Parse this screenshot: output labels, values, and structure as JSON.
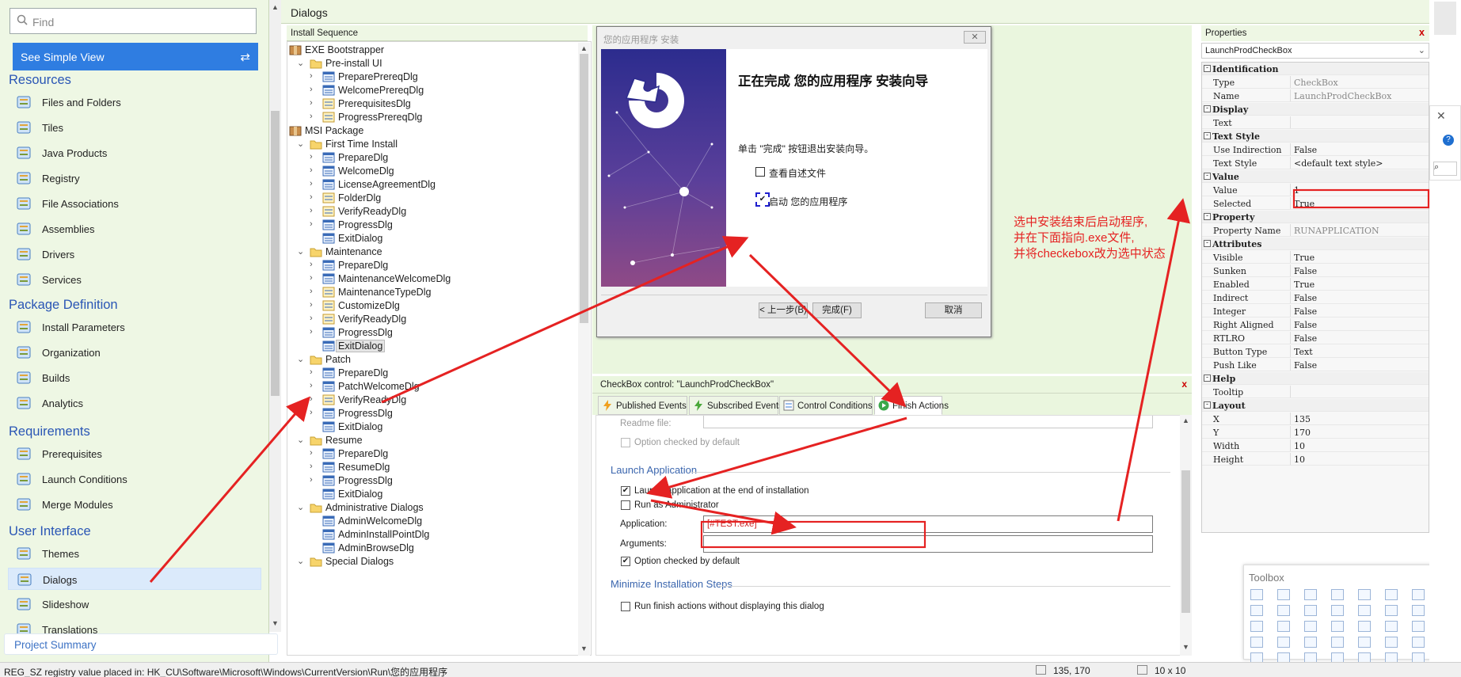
{
  "left_nav": {
    "find_placeholder": "Find",
    "simple_view_label": "See Simple View",
    "sections": [
      {
        "title": "Resources",
        "items": [
          "Files and Folders",
          "Tiles",
          "Java Products",
          "Registry",
          "File Associations",
          "Assemblies",
          "Drivers",
          "Services"
        ]
      },
      {
        "title": "Package Definition",
        "items": [
          "Install Parameters",
          "Organization",
          "Builds",
          "Analytics"
        ]
      },
      {
        "title": "Requirements",
        "items": [
          "Prerequisites",
          "Launch Conditions",
          "Merge Modules"
        ]
      },
      {
        "title": "User Interface",
        "items": [
          "Themes",
          "Dialogs",
          "Slideshow",
          "Translations"
        ]
      }
    ],
    "selected_item": "Dialogs",
    "project_summary": "Project Summary"
  },
  "main_title": "Dialogs",
  "install_sequence": {
    "header": "Install Sequence",
    "nodes": [
      {
        "level": 0,
        "label": "EXE Bootstrapper",
        "type": "package"
      },
      {
        "level": 1,
        "label": "Pre-install UI",
        "type": "folder",
        "expanded": true
      },
      {
        "level": 2,
        "label": "PreparePrereqDlg",
        "type": "dialog"
      },
      {
        "level": 2,
        "label": "WelcomePrereqDlg",
        "type": "dialog"
      },
      {
        "level": 2,
        "label": "PrerequisitesDlg",
        "type": "dialog-alt"
      },
      {
        "level": 2,
        "label": "ProgressPrereqDlg",
        "type": "dialog-alt"
      },
      {
        "level": 0,
        "label": "MSI Package",
        "type": "package"
      },
      {
        "level": 1,
        "label": "First Time Install",
        "type": "folder",
        "expanded": true
      },
      {
        "level": 2,
        "label": "PrepareDlg",
        "type": "dialog"
      },
      {
        "level": 2,
        "label": "WelcomeDlg",
        "type": "dialog"
      },
      {
        "level": 2,
        "label": "LicenseAgreementDlg",
        "type": "dialog"
      },
      {
        "level": 2,
        "label": "FolderDlg",
        "type": "dialog-alt"
      },
      {
        "level": 2,
        "label": "VerifyReadyDlg",
        "type": "dialog-alt"
      },
      {
        "level": 2,
        "label": "ProgressDlg",
        "type": "dialog"
      },
      {
        "level": 2,
        "label": "ExitDialog",
        "type": "dialog",
        "leaf": true
      },
      {
        "level": 1,
        "label": "Maintenance",
        "type": "folder",
        "expanded": true
      },
      {
        "level": 2,
        "label": "PrepareDlg",
        "type": "dialog"
      },
      {
        "level": 2,
        "label": "MaintenanceWelcomeDlg",
        "type": "dialog"
      },
      {
        "level": 2,
        "label": "MaintenanceTypeDlg",
        "type": "dialog-alt"
      },
      {
        "level": 2,
        "label": "CustomizeDlg",
        "type": "dialog-alt"
      },
      {
        "level": 2,
        "label": "VerifyReadyDlg",
        "type": "dialog-alt"
      },
      {
        "level": 2,
        "label": "ProgressDlg",
        "type": "dialog"
      },
      {
        "level": 2,
        "label": "ExitDialog",
        "type": "dialog",
        "leaf": true,
        "selected": true
      },
      {
        "level": 1,
        "label": "Patch",
        "type": "folder",
        "expanded": true
      },
      {
        "level": 2,
        "label": "PrepareDlg",
        "type": "dialog"
      },
      {
        "level": 2,
        "label": "PatchWelcomeDlg",
        "type": "dialog"
      },
      {
        "level": 2,
        "label": "VerifyReadyDlg",
        "type": "dialog-alt"
      },
      {
        "level": 2,
        "label": "ProgressDlg",
        "type": "dialog"
      },
      {
        "level": 2,
        "label": "ExitDialog",
        "type": "dialog",
        "leaf": true
      },
      {
        "level": 1,
        "label": "Resume",
        "type": "folder",
        "expanded": true
      },
      {
        "level": 2,
        "label": "PrepareDlg",
        "type": "dialog"
      },
      {
        "level": 2,
        "label": "ResumeDlg",
        "type": "dialog"
      },
      {
        "level": 2,
        "label": "ProgressDlg",
        "type": "dialog"
      },
      {
        "level": 2,
        "label": "ExitDialog",
        "type": "dialog",
        "leaf": true
      },
      {
        "level": 1,
        "label": "Administrative Dialogs",
        "type": "folder",
        "expanded": true
      },
      {
        "level": 2,
        "label": "AdminWelcomeDlg",
        "type": "dialog",
        "leaf": true
      },
      {
        "level": 2,
        "label": "AdminInstallPointDlg",
        "type": "dialog",
        "leaf": true
      },
      {
        "level": 2,
        "label": "AdminBrowseDlg",
        "type": "dialog",
        "leaf": true
      },
      {
        "level": 1,
        "label": "Special Dialogs",
        "type": "folder",
        "expanded": true
      }
    ]
  },
  "preview_dialog": {
    "title": "您的应用程序 安装",
    "close_glyph": "✕",
    "heading": "正在完成 您的应用程序 安装向导",
    "body": "单击 \"完成\" 按钮退出安装向导。",
    "readme_checkbox": "查看自述文件",
    "launch_checkbox": "启动 您的应用程序",
    "buttons": {
      "back": "< 上一步(B)",
      "finish": "完成(F)",
      "cancel": "取消"
    }
  },
  "checkbox_control": {
    "header": "CheckBox control: \"LaunchProdCheckBox\"",
    "close_glyph": "x",
    "tabs": [
      "Published Events",
      "Subscribed Events",
      "Control Conditions",
      "Finish Actions"
    ],
    "active_tab": "Finish Actions",
    "readme_file_label": "Readme file:",
    "readme_option": "Option checked by default",
    "launch_section": "Launch Application",
    "launch_checkbox": "Launch application at the end of installation",
    "run_admin": "Run as Administrator",
    "application_label": "Application:",
    "application_value": "[#TEST.exe]",
    "arguments_label": "Arguments:",
    "arguments_value": "",
    "launch_option": "Option checked by default",
    "minimize_section": "Minimize Installation Steps",
    "minimize_checkbox": "Run finish actions without displaying this dialog"
  },
  "properties": {
    "header": "Properties",
    "close_glyph": "x",
    "selected_control": "LaunchProdCheckBox",
    "rows": [
      {
        "cat": true,
        "k": "Identification"
      },
      {
        "k": "Type",
        "v": "CheckBox",
        "dim": true
      },
      {
        "k": "Name",
        "v": "LaunchProdCheckBox",
        "dim": true
      },
      {
        "cat": true,
        "k": "Display"
      },
      {
        "k": "Text",
        "v": ""
      },
      {
        "cat": true,
        "k": "Text Style"
      },
      {
        "k": "Use Indirection",
        "v": "False"
      },
      {
        "k": "Text Style",
        "v": "<default text style>"
      },
      {
        "cat": true,
        "k": "Value"
      },
      {
        "k": "Value",
        "v": "1"
      },
      {
        "k": "Selected",
        "v": "True"
      },
      {
        "cat": true,
        "k": "Property"
      },
      {
        "k": "Property Name",
        "v": "RUNAPPLICATION",
        "dim": true
      },
      {
        "cat": true,
        "k": "Attributes"
      },
      {
        "k": "Visible",
        "v": "True"
      },
      {
        "k": "Sunken",
        "v": "False"
      },
      {
        "k": "Enabled",
        "v": "True"
      },
      {
        "k": "Indirect",
        "v": "False"
      },
      {
        "k": "Integer",
        "v": "False"
      },
      {
        "k": "Right Aligned",
        "v": "False"
      },
      {
        "k": "RTLRO",
        "v": "False"
      },
      {
        "k": "Button Type",
        "v": "Text"
      },
      {
        "k": "Push Like",
        "v": "False"
      },
      {
        "cat": true,
        "k": "Help"
      },
      {
        "k": "Tooltip",
        "v": ""
      },
      {
        "cat": true,
        "k": "Layout"
      },
      {
        "k": "X",
        "v": "135"
      },
      {
        "k": "Y",
        "v": "170"
      },
      {
        "k": "Width",
        "v": "10"
      },
      {
        "k": "Height",
        "v": "10"
      }
    ]
  },
  "annotation": {
    "lines": [
      "选中安装结束后启动程序,",
      "并在下面指向.exe文件,",
      "并将checkebox改为选中状态"
    ],
    "color": "#e52222"
  },
  "toolbox": {
    "title": "Toolbox"
  },
  "status_bar": {
    "message": "REG_SZ registry value placed in: HK_CU\\Software\\Microsoft\\Windows\\CurrentVersion\\Run\\您的应用程序",
    "position": "135, 170",
    "size": "10 x 10"
  },
  "colors": {
    "accent_blue": "#2f7de1",
    "panel_green": "#eef7e4",
    "annotation_red": "#e52222"
  }
}
